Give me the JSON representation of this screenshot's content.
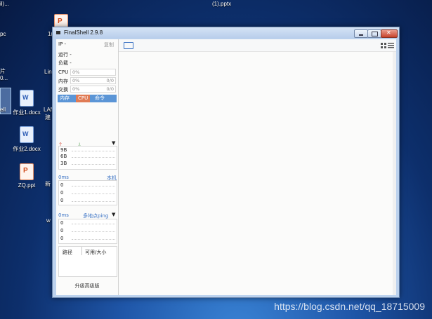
{
  "desktop": {
    "top_left_text": "il)...",
    "top_center_text": "(1).pptx",
    "left_texts": [
      "pc",
      "片",
      "0...",
      "ell"
    ],
    "partial_texts": [
      "1(",
      "Lin",
      "LAN",
      "建",
      "新",
      "w"
    ],
    "icons": [
      {
        "label": "作业1.docx",
        "type": "word"
      },
      {
        "label": "作业2.docx",
        "type": "word"
      },
      {
        "label": "ZQ.ppt",
        "type": "ppt"
      },
      {
        "label": "",
        "type": "ppt"
      }
    ],
    "watermark": "https://blog.csdn.net/qq_18715009"
  },
  "window": {
    "title": "FinalShell 2.9.8",
    "sidebar": {
      "ip_label": "IP  -",
      "copy": "复制",
      "running": "运行 -",
      "load": "负载 -",
      "meters": [
        {
          "label": "CPU",
          "value": "0%",
          "right": ""
        },
        {
          "label": "内存",
          "value": "0%",
          "right": "0/0"
        },
        {
          "label": "交换",
          "value": "0%",
          "right": "0/0"
        }
      ],
      "tabs": [
        "内存",
        "CPU",
        "命令"
      ],
      "net_labels": [
        "9B",
        "6B",
        "3B"
      ],
      "ping_latency": "0ms",
      "ping_target": "本机",
      "ping_values": [
        "0",
        "0",
        "0"
      ],
      "ping2_latency": "0ms",
      "ping2_target": "多地点ping",
      "ping2_values": [
        "0",
        "0",
        "0"
      ],
      "disk_col_path": "路径",
      "disk_col_size": "可用/大小",
      "upgrade": "升级高级版"
    }
  }
}
